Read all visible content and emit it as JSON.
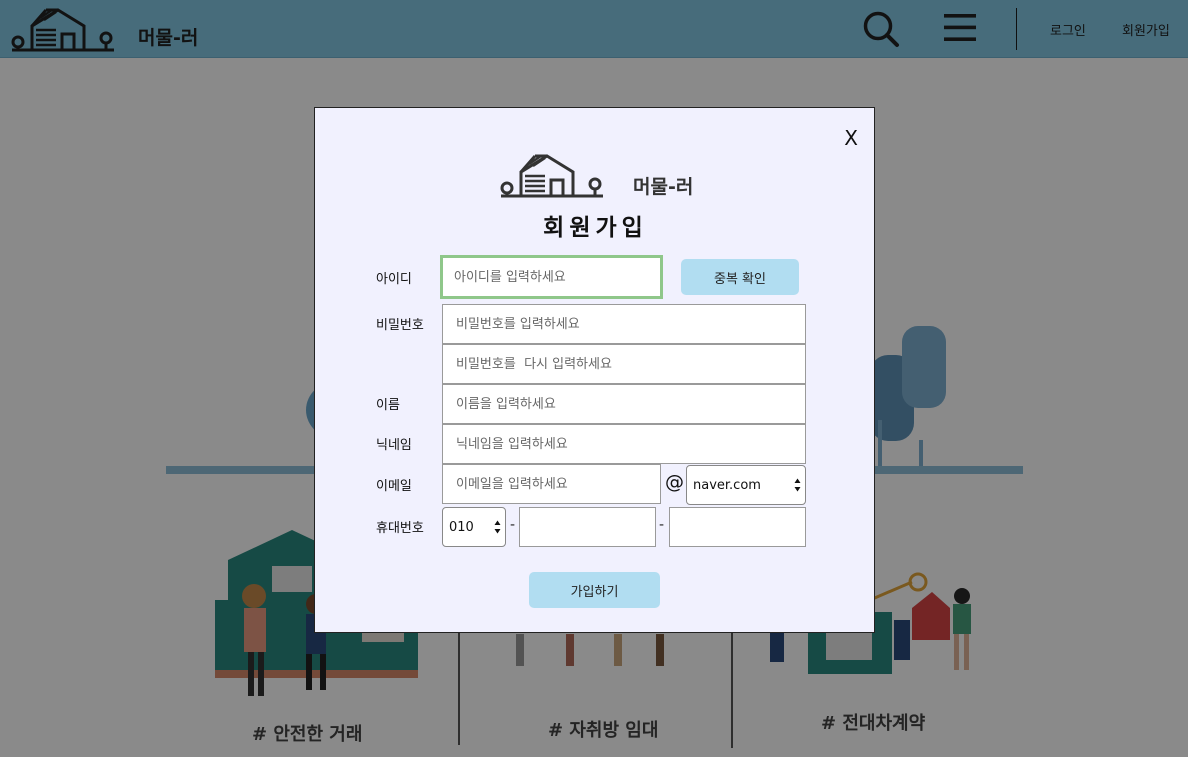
{
  "header": {
    "brand": "머물-러",
    "login": "로그인",
    "signup": "회원가입"
  },
  "background": {
    "features": [
      "# 안전한 거래",
      "# 자취방 임대",
      "# 전대차계약"
    ]
  },
  "modal": {
    "close": "X",
    "brand": "머물-러",
    "title": "회원가입",
    "labels": {
      "id": "아이디",
      "password": "비밀번호",
      "name": "이름",
      "nickname": "닉네임",
      "email": "이메일",
      "phone": "휴대번호"
    },
    "placeholders": {
      "id": "아이디를 입력하세요",
      "password": "비밀번호를 입력하세요",
      "password_confirm": "비밀번호를  다시 입력하세요",
      "name": "이름을 입력하세요",
      "nickname": "닉네임을 입력하세요",
      "email": "이메일을 입력하세요"
    },
    "dup_check": "중복 확인",
    "at": "@",
    "email_domain": "naver.com",
    "phone_prefix": "010",
    "dash": "-",
    "submit": "가입하기"
  },
  "colors": {
    "header_bg": "#84c8e4",
    "modal_bg": "#f1f1fe",
    "button_bg": "#b1ddf1",
    "focus_border": "#8fc78a",
    "overlay": "rgba(0,0,0,0.46)"
  },
  "icons": [
    "house-logo-icon",
    "search-icon",
    "hamburger-menu-icon",
    "select-arrows-icon"
  ]
}
